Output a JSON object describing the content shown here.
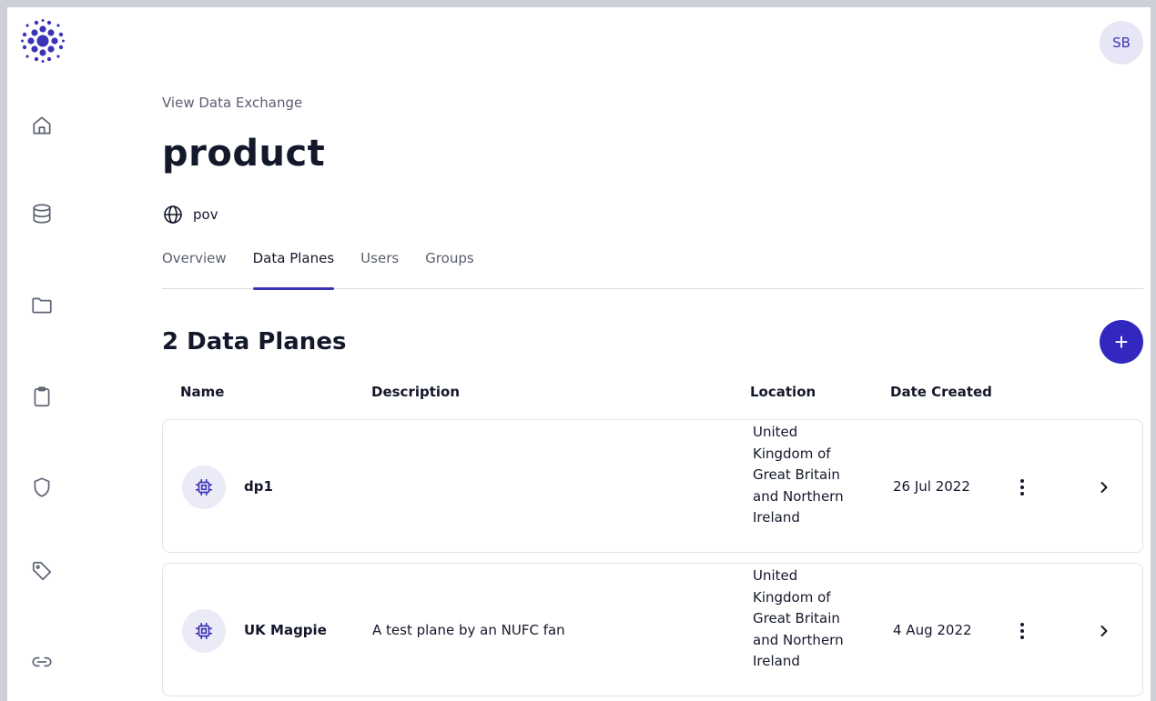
{
  "user": {
    "initials": "SB"
  },
  "breadcrumb": "View Data Exchange",
  "title": "product",
  "scope": {
    "icon": "globe-icon",
    "label": "pov"
  },
  "tabs": [
    {
      "label": "Overview",
      "active": false
    },
    {
      "label": "Data Planes",
      "active": true
    },
    {
      "label": "Users",
      "active": false
    },
    {
      "label": "Groups",
      "active": false
    }
  ],
  "section_title": "2 Data Planes",
  "add_button_label": "+",
  "columns": {
    "name": "Name",
    "description": "Description",
    "location": "Location",
    "date_created": "Date Created"
  },
  "rows": [
    {
      "name": "dp1",
      "description": "",
      "location": "United Kingdom of Great Britain and Northern Ireland",
      "date_created": "26 Jul 2022"
    },
    {
      "name": "UK Magpie",
      "description": "A test plane by an NUFC fan",
      "location": "United Kingdom of Great Britain and Northern Ireland",
      "date_created": "4 Aug 2022"
    }
  ],
  "sidebar": {
    "items": [
      {
        "icon": "home-icon"
      },
      {
        "icon": "database-icon"
      },
      {
        "icon": "folder-icon"
      },
      {
        "icon": "clipboard-icon"
      },
      {
        "icon": "shield-icon"
      },
      {
        "icon": "tag-icon"
      },
      {
        "icon": "link-icon"
      }
    ]
  },
  "colors": {
    "accent": "#3228c0",
    "accent_light": "#ebeaf7",
    "text": "#14182b",
    "muted": "#5a5f70"
  }
}
